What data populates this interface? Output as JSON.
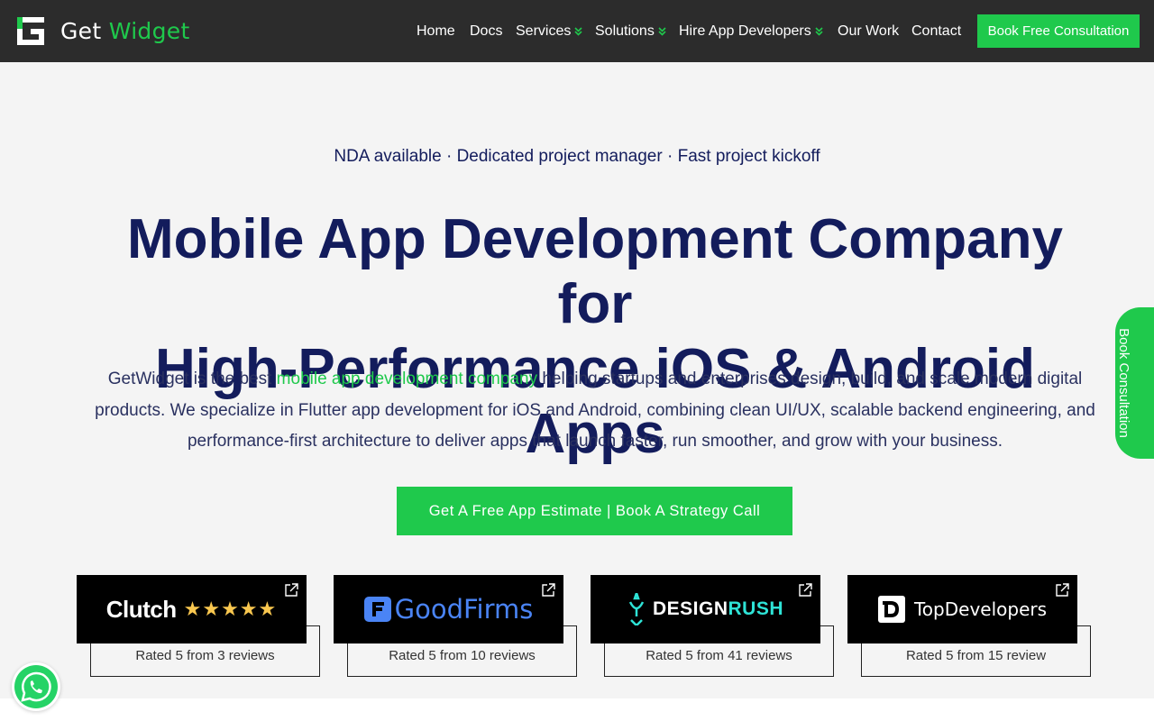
{
  "nav": {
    "logo_word1": "Get",
    "logo_word2": "Widget",
    "items": [
      {
        "label": "Home"
      },
      {
        "label": "Docs"
      },
      {
        "label": "Services"
      },
      {
        "label": "Solutions"
      },
      {
        "label": "Hire App Developers"
      },
      {
        "label": "Our Work"
      },
      {
        "label": "Contact"
      }
    ],
    "book_button": "Book Free Consultation"
  },
  "hero": {
    "tagline": "NDA available · Dedicated project manager · Fast project kickoff",
    "headline_line1": "Mobile App Development Company for",
    "headline_line2": "High-Performance iOS & Android Apps",
    "desc_before_link": "GetWidget is the best ",
    "desc_link": "mobile app development company",
    "desc_after_link": " helping startups and enterprises design, build, and scale modern digital products. We specialize in Flutter app development for iOS and Android, combining clean UI/UX, scalable backend engineering, and performance-first architecture to deliver apps that launch faster, run smoother, and grow with your business.",
    "cta": "Get A Free App Estimate | Book A Strategy Call"
  },
  "reviews": [
    {
      "brand": "Clutch",
      "rating_text": "Rated 5 from 3 reviews",
      "stars": 5
    },
    {
      "brand": "GoodFirms",
      "rating_text": "Rated 5 from 10 reviews"
    },
    {
      "brand_part1": "DESIGN",
      "brand_part2": "RUSH",
      "rating_text": "Rated 5 from 41 reviews"
    },
    {
      "brand": "TopDevelopers",
      "rating_text": "Rated 5 from 15 review"
    }
  ],
  "side_tab": "Book Consultation",
  "colors": {
    "accent": "#1fc94c",
    "navy": "#131c5c",
    "nav_bg": "#2c2c2c"
  }
}
